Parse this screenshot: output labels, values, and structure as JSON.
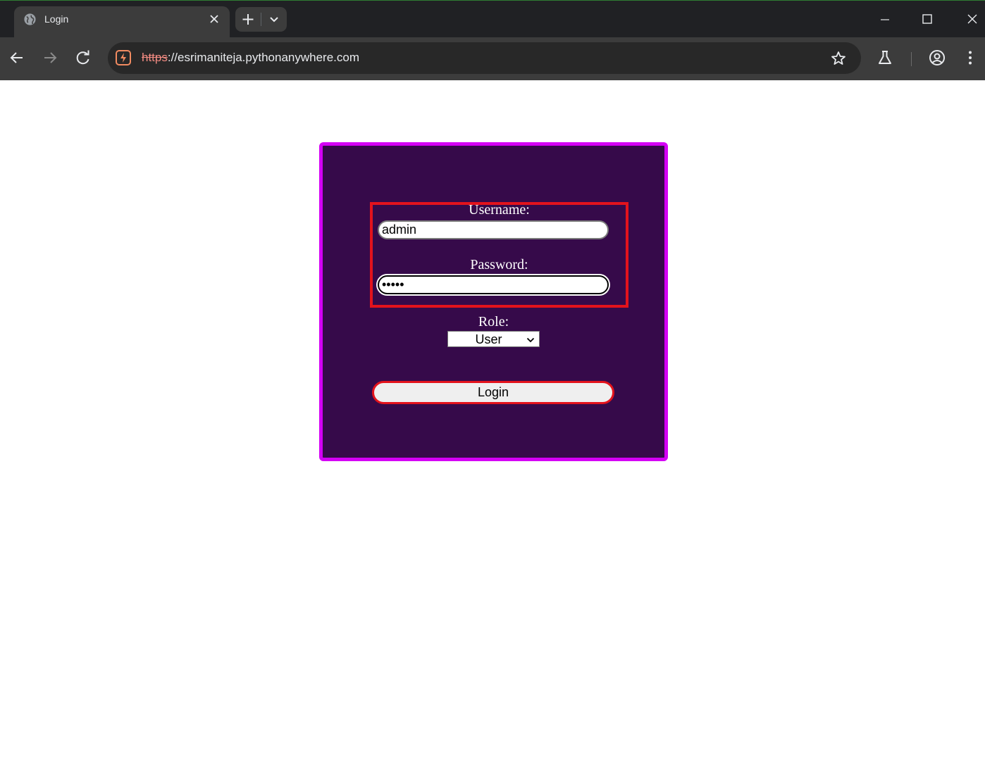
{
  "browser": {
    "tab": {
      "title": "Login"
    },
    "address_bar": {
      "scheme": "https",
      "rest": "://esrimaniteja.pythonanywhere.com"
    }
  },
  "login": {
    "username_label": "Username:",
    "username_value": "admin",
    "password_label": "Password:",
    "password_value": "•••••",
    "role_label": "Role:",
    "role_selected": "User",
    "submit_label": "Login"
  },
  "colors": {
    "panel_background": "#360a4a",
    "panel_border": "#d400f5",
    "highlight_border": "#e3131c"
  }
}
